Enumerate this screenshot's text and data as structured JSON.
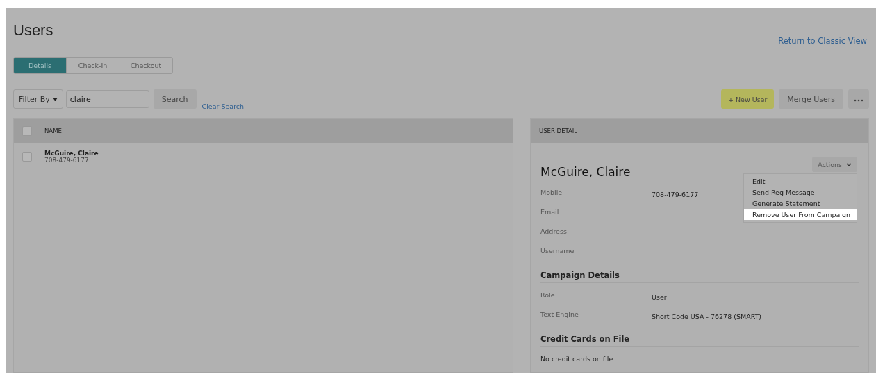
{
  "page": {
    "title": "Users",
    "classic_link": "Return to Classic View"
  },
  "tabs": [
    {
      "label": "Details",
      "selected": true
    },
    {
      "label": "Check-In",
      "selected": false
    },
    {
      "label": "Checkout",
      "selected": false
    }
  ],
  "filter": {
    "label": "Filter By",
    "search_value": "claire",
    "search_button": "Search",
    "clear_link": "Clear Search"
  },
  "toolbar": {
    "new_user": "+ New User",
    "merge": "Merge Users"
  },
  "table": {
    "columns": [
      "NAME"
    ],
    "select_all_checked": false,
    "rows": [
      {
        "name": "McGuire, Claire",
        "phone": "708-479-6177",
        "checked": false
      }
    ]
  },
  "detail": {
    "header": "USER DETAIL",
    "name": "McGuire, Claire",
    "actions": "Actions",
    "menu": [
      {
        "label": "Edit",
        "selected": false
      },
      {
        "label": "Send Reg Message",
        "selected": false
      },
      {
        "label": "Generate Statement",
        "selected": false
      },
      {
        "label": "Remove User From Campaign",
        "selected": true
      }
    ],
    "fields": [
      {
        "label": "Mobile",
        "value": "708-479-6177"
      },
      {
        "label": "Email"
      },
      {
        "label": "Address"
      },
      {
        "label": "Username"
      }
    ],
    "sections": [
      {
        "title": "Campaign Details",
        "fields": [
          {
            "label": "Role",
            "value": "User"
          },
          {
            "label": "Text Engine",
            "value": "Short Code USA - 76278 (SMART)"
          }
        ]
      },
      {
        "title": "Credit Cards on File",
        "note": "No credit cards on file."
      }
    ]
  }
}
